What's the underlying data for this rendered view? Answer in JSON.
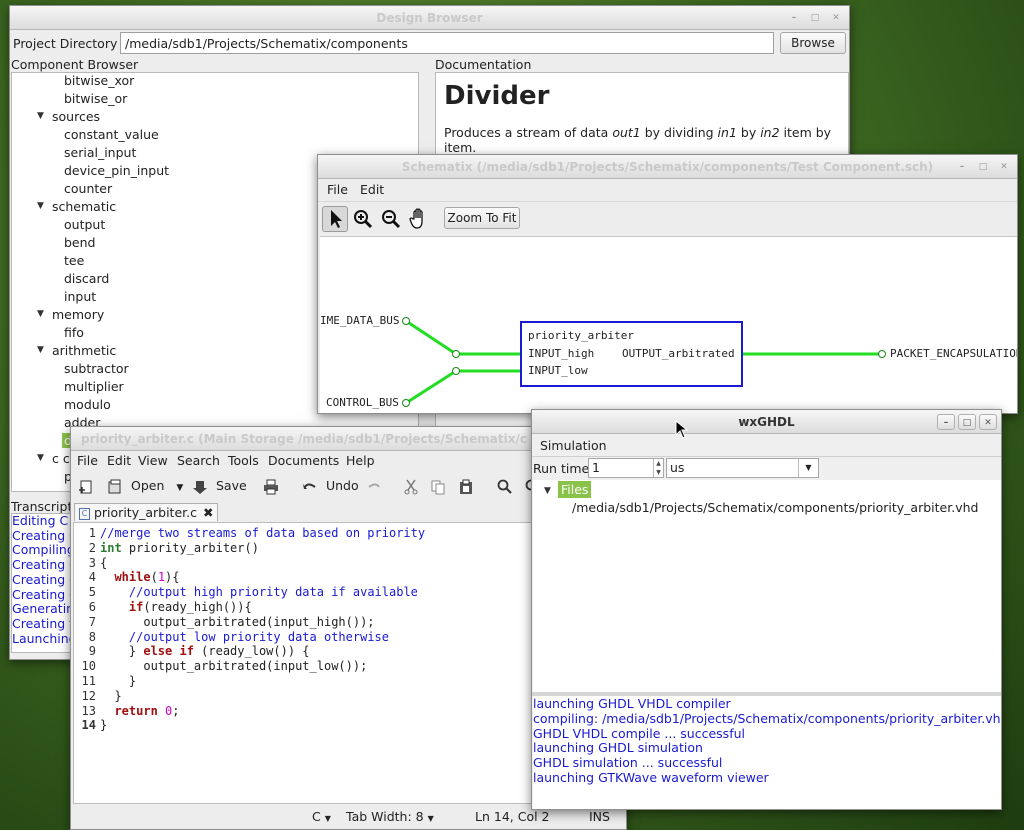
{
  "design_browser": {
    "title": "Design Browser",
    "project_dir_label": "Project Directory",
    "project_dir_value": "/media/sdb1/Projects/Schematix/components",
    "browse_label": "Browse",
    "component_browser_label": "Component Browser",
    "documentation_label": "Documentation",
    "doc_heading": "Divider",
    "doc_text": {
      "t1": "Produces a stream of data ",
      "out1": "out1",
      "t2": " by dividing ",
      "in1": "in1",
      "t3": " by ",
      "in2": "in2",
      "t4": " item by item."
    },
    "tree": [
      {
        "label": "bitwise_xor"
      },
      {
        "label": "bitwise_or"
      },
      {
        "label": "sources"
      },
      {
        "label": "constant_value"
      },
      {
        "label": "serial_input"
      },
      {
        "label": "device_pin_input"
      },
      {
        "label": "counter"
      },
      {
        "label": "schematic"
      },
      {
        "label": "output"
      },
      {
        "label": "bend"
      },
      {
        "label": "tee"
      },
      {
        "label": "discard"
      },
      {
        "label": "input"
      },
      {
        "label": "memory"
      },
      {
        "label": "fifo"
      },
      {
        "label": "arithmetic"
      },
      {
        "label": "subtractor"
      },
      {
        "label": "multiplier"
      },
      {
        "label": "modulo"
      },
      {
        "label": "adder"
      },
      {
        "label": "d"
      },
      {
        "label": "c co"
      },
      {
        "label": "p"
      }
    ],
    "transcript_label": "Transcript",
    "transcript": [
      "Editing C",
      "Creating C",
      "Compiling",
      "Creating C",
      "Creating C",
      "Creating C",
      "Generating",
      "Creating f",
      "Launching"
    ]
  },
  "schematix": {
    "title": "Schematix (/media/sdb1/Projects/Schematix/components/Test Component.sch)",
    "menu": [
      "File",
      "Edit"
    ],
    "zoom_to_fit": "Zoom To Fit",
    "block_name": "priority_arbiter",
    "port_in_high": "INPUT_high",
    "port_in_low": "INPUT_low",
    "port_out": "OUTPUT_arbitrated",
    "bus_time": "IME_DATA_BUS",
    "bus_control": "CONTROL_BUS",
    "bus_packet": "PACKET_ENCAPSULATION",
    "colors": {
      "wire": "#22dd22",
      "block": "#1a1ad2"
    }
  },
  "editor": {
    "title": "priority_arbiter.c (Main Storage /media/sdb1/Projects/Schematix/c",
    "menu": [
      "File",
      "Edit",
      "View",
      "Search",
      "Tools",
      "Documents",
      "Help"
    ],
    "toolbar": {
      "open": "Open",
      "save": "Save",
      "undo": "Undo"
    },
    "tab_label": "priority_arbiter.c",
    "lines": [
      {
        "n": "1",
        "html": "<span class='cm'>//merge two streams of data based on priority</span>"
      },
      {
        "n": "2",
        "html": "<span class='ty'>int</span> priority_arbiter()"
      },
      {
        "n": "3",
        "html": "{"
      },
      {
        "n": "4",
        "html": "  <span class='kw'>while</span>(<span class='nm'>1</span>){"
      },
      {
        "n": "5",
        "html": "    <span class='cm'>//output high priority data if available</span>"
      },
      {
        "n": "6",
        "html": "    <span class='kw'>if</span>(ready_high()){"
      },
      {
        "n": "7",
        "html": "      output_arbitrated(input_high());"
      },
      {
        "n": "8",
        "html": "    <span class='cm'>//output low priority data otherwise</span>"
      },
      {
        "n": "9",
        "html": "    } <span class='kw'>else if</span> (ready_low()) {"
      },
      {
        "n": "10",
        "html": "      output_arbitrated(input_low());"
      },
      {
        "n": "11",
        "html": "    }"
      },
      {
        "n": "12",
        "html": "  }"
      },
      {
        "n": "13",
        "html": "  <span class='kw'>return</span> <span class='nm'>0</span>;"
      },
      {
        "n": "14",
        "html": "}"
      }
    ],
    "status": {
      "lang": "C",
      "tab_width_label": "Tab Width:",
      "tab_width": "8",
      "pos": "Ln 14, Col 2",
      "mode": "INS"
    }
  },
  "wxghdl": {
    "title": "wxGHDL",
    "menu": "Simulation",
    "run_time_label": "Run time",
    "run_time_value": "1",
    "unit": "us",
    "files_label": "Files",
    "file_path": "/media/sdb1/Projects/Schematix/components/priority_arbiter.vhd",
    "log": [
      {
        "text": "launching GHDL VHDL compiler",
        "color": "#1a1ad2"
      },
      {
        "text": "compiling: /media/sdb1/Projects/Schematix/components/priority_arbiter.vhd",
        "color": "#1a1ad2"
      },
      {
        "text": "GHDL VHDL compile ... successful",
        "color": "#1a1ad2"
      },
      {
        "text": "launching GHDL simulation",
        "color": "#1a1ad2"
      },
      {
        "text": "GHDL simulation ... successful",
        "color": "#1a1ad2"
      },
      {
        "text": "launching GTKWave waveform viewer",
        "color": "#1a1ad2"
      }
    ]
  }
}
